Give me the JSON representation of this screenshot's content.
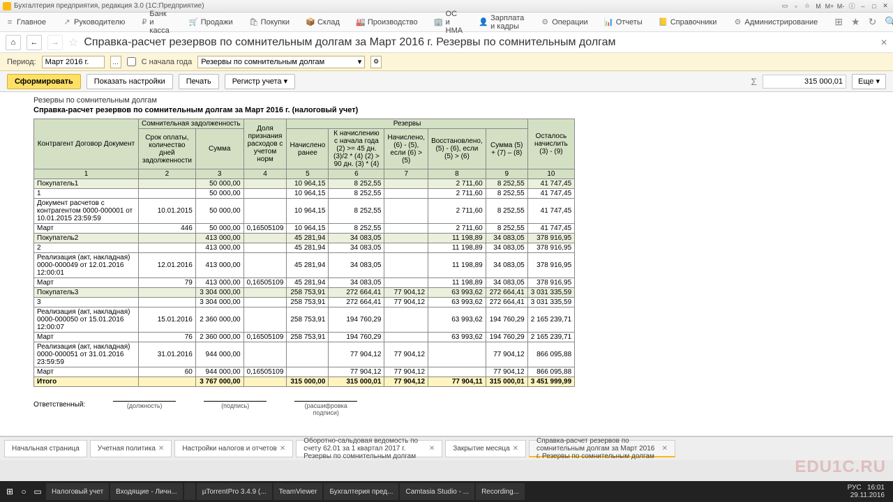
{
  "window": {
    "title": "Бухгалтерия предприятия, редакция 3.0  (1С:Предприятие)"
  },
  "menu": {
    "items": [
      "Главное",
      "Руководителю",
      "Банк и касса",
      "Продажи",
      "Покупки",
      "Склад",
      "Производство",
      "ОС и НМА",
      "Зарплата и кадры",
      "Операции",
      "Отчеты",
      "Справочники",
      "Администрирование"
    ]
  },
  "page_title": "Справка-расчет резервов по сомнительным долгам за Март 2016 г. Резервы по сомнительным долгам",
  "params": {
    "period_label": "Период:",
    "period_value": "Март 2016 г.",
    "from_year_label": "С начала года",
    "filter_value": "Резервы по сомнительным долгам"
  },
  "toolbar": {
    "form": "Сформировать",
    "settings": "Показать настройки",
    "print": "Печать",
    "register": "Регистр учета",
    "more": "Еще",
    "sum_value": "315 000,01"
  },
  "report": {
    "heading1": "Резервы по сомнительным долгам",
    "heading2": "Справка-расчет резервов по сомнительным долгам за Март 2016 г. (налоговый учет)",
    "responsible": "Ответственный:",
    "sign_labels": [
      "(должность)",
      "(подпись)",
      "(расшифровка подписи)"
    ],
    "headers": {
      "group_somn": "Сомнительная задолженность",
      "group_res": "Резервы",
      "col1": "Контрагент\nДоговор\nДокумент",
      "col2": "Срок оплаты, количество дней задолженности",
      "col3": "Сумма",
      "col4": "Доля признания расходов с учетом норм",
      "col5": "Начислено ранее",
      "col6": "К начислению с начала года (2) >= 45 дн. (3)/2 * (4) (2) > 90 дн. (3) * (4)",
      "col7": "Начислено, (6) - (5), если (6) > (5)",
      "col8": "Восстановлено, (5) - (6), если (5) > (6)",
      "col9": "Сумма (5) + (7) – (8)",
      "col10": "Осталось начислить (3) - (9)",
      "nums": [
        "1",
        "2",
        "3",
        "4",
        "5",
        "6",
        "7",
        "8",
        "9",
        "10"
      ]
    },
    "rows": [
      {
        "cls": "grp",
        "c": [
          "Покупатель1",
          "",
          "50 000,00",
          "",
          "10 964,15",
          "8 252,55",
          "",
          "2 711,60",
          "8 252,55",
          "41 747,45"
        ]
      },
      {
        "cls": "",
        "c": [
          "1",
          "",
          "50 000,00",
          "",
          "10 964,15",
          "8 252,55",
          "",
          "2 711,60",
          "8 252,55",
          "41 747,45"
        ]
      },
      {
        "cls": "",
        "c": [
          "Документ расчетов с контрагентом 0000-000001 от 10.01.2015 23:59:59",
          "10.01.2015",
          "50 000,00",
          "",
          "10 964,15",
          "8 252,55",
          "",
          "2 711,60",
          "8 252,55",
          "41 747,45"
        ]
      },
      {
        "cls": "",
        "c": [
          "Март",
          "446",
          "50 000,00",
          "0,16505109",
          "10 964,15",
          "8 252,55",
          "",
          "2 711,60",
          "8 252,55",
          "41 747,45"
        ]
      },
      {
        "cls": "grp",
        "c": [
          "Покупатель2",
          "",
          "413 000,00",
          "",
          "45 281,94",
          "34 083,05",
          "",
          "11 198,89",
          "34 083,05",
          "378 916,95"
        ]
      },
      {
        "cls": "",
        "c": [
          "2",
          "",
          "413 000,00",
          "",
          "45 281,94",
          "34 083,05",
          "",
          "11 198,89",
          "34 083,05",
          "378 916,95"
        ]
      },
      {
        "cls": "",
        "c": [
          "Реализация (акт, накладная) 0000-000049 от 12.01.2016 12:00:01",
          "12.01.2016",
          "413 000,00",
          "",
          "45 281,94",
          "34 083,05",
          "",
          "11 198,89",
          "34 083,05",
          "378 916,95"
        ]
      },
      {
        "cls": "",
        "c": [
          "Март",
          "79",
          "413 000,00",
          "0,16505109",
          "45 281,94",
          "34 083,05",
          "",
          "11 198,89",
          "34 083,05",
          "378 916,95"
        ]
      },
      {
        "cls": "grp",
        "c": [
          "Покупатель3",
          "",
          "3 304 000,00",
          "",
          "258 753,91",
          "272 664,41",
          "77 904,12",
          "63 993,62",
          "272 664,41",
          "3 031 335,59"
        ]
      },
      {
        "cls": "",
        "c": [
          "3",
          "",
          "3 304 000,00",
          "",
          "258 753,91",
          "272 664,41",
          "77 904,12",
          "63 993,62",
          "272 664,41",
          "3 031 335,59"
        ]
      },
      {
        "cls": "",
        "c": [
          "Реализация (акт, накладная) 0000-000050 от 15.01.2016 12:00:07",
          "15.01.2016",
          "2 360 000,00",
          "",
          "258 753,91",
          "194 760,29",
          "",
          "63 993,62",
          "194 760,29",
          "2 165 239,71"
        ]
      },
      {
        "cls": "",
        "c": [
          "Март",
          "76",
          "2 360 000,00",
          "0,16505109",
          "258 753,91",
          "194 760,29",
          "",
          "63 993,62",
          "194 760,29",
          "2 165 239,71"
        ]
      },
      {
        "cls": "",
        "c": [
          "Реализация (акт, накладная) 0000-000051 от 31.01.2016 23:59:59",
          "31.01.2016",
          "944 000,00",
          "",
          "",
          "77 904,12",
          "77 904,12",
          "",
          "77 904,12",
          "866 095,88"
        ]
      },
      {
        "cls": "",
        "c": [
          "Март",
          "60",
          "944 000,00",
          "0,16505109",
          "",
          "77 904,12",
          "77 904,12",
          "",
          "77 904,12",
          "866 095,88"
        ]
      },
      {
        "cls": "total",
        "c": [
          "Итого",
          "",
          "3 767 000,00",
          "",
          "315 000,00",
          "315 000,01",
          "77 904,12",
          "77 904,11",
          "315 000,01",
          "3 451 999,99"
        ]
      }
    ]
  },
  "tabs": {
    "items": [
      {
        "label": "Начальная страница",
        "closable": false
      },
      {
        "label": "Учетная политика",
        "closable": true
      },
      {
        "label": "Настройки налогов и отчетов",
        "closable": true
      },
      {
        "label": "Оборотно-сальдовая ведомость по счету 62.01 за 1 квартал 2017 г. Резервы по сомнительным долгам",
        "closable": true
      },
      {
        "label": "Закрытие месяца",
        "closable": true
      },
      {
        "label": "Справка-расчет резервов по сомнительным долгам за Март 2016 г. Резервы по сомнительным долгам",
        "closable": true,
        "active": true
      }
    ]
  },
  "taskbar": {
    "items": [
      "Налоговый учет",
      "Входящие - Личн...",
      "",
      "µTorrentPro 3.4.9 (...",
      "TeamViewer",
      "Бухгалтерия пред...",
      "Camtasia Studio - ...",
      "Recording..."
    ],
    "time": "16:01",
    "date": "29.11.2016",
    "lang": "РУС"
  },
  "watermark": "EDU1C.RU"
}
